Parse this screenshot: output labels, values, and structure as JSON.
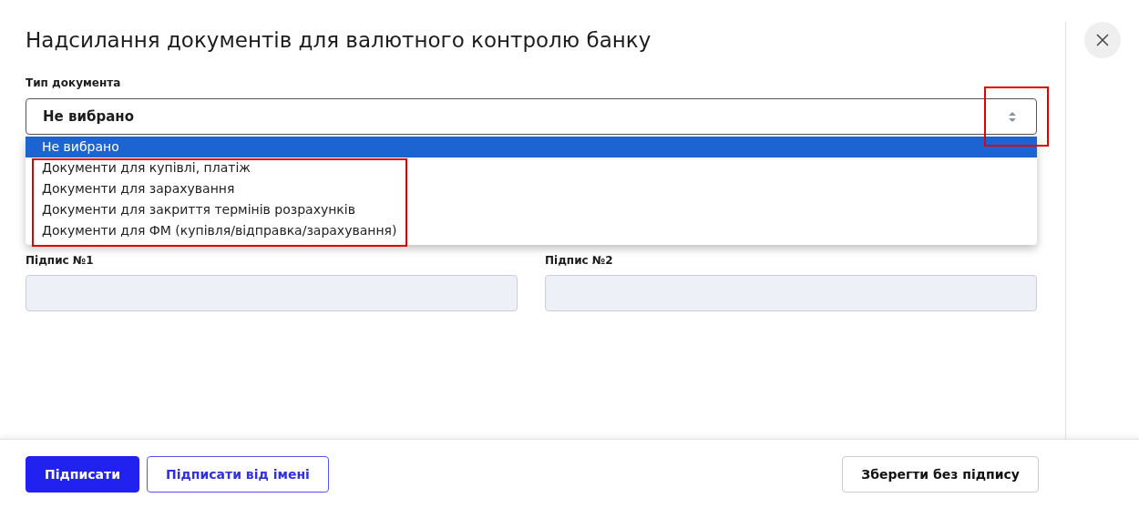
{
  "title": "Надсилання документів для валютного контролю банку",
  "document_type": {
    "label": "Тип документа",
    "value": "Не вибрано",
    "expanded": true,
    "options": [
      {
        "label": "Не вибрано",
        "selected": true
      },
      {
        "label": "Документи для купівлі, платіж",
        "selected": false
      },
      {
        "label": "Документи для зарахування",
        "selected": false
      },
      {
        "label": "Документи для закриття термінів розрахунків",
        "selected": false
      },
      {
        "label": "Документи для ФМ (купівля/відправка/зарахування)",
        "selected": false
      }
    ]
  },
  "signatures": [
    {
      "label": "Підпис №1"
    },
    {
      "label": "Підпис №2"
    }
  ],
  "buttons": [
    {
      "label": "Підписати",
      "kind": "primary"
    },
    {
      "label": "Підписати від імені",
      "kind": "outline"
    },
    {
      "label": "Зберегти без підпису",
      "kind": "secondary"
    }
  ]
}
